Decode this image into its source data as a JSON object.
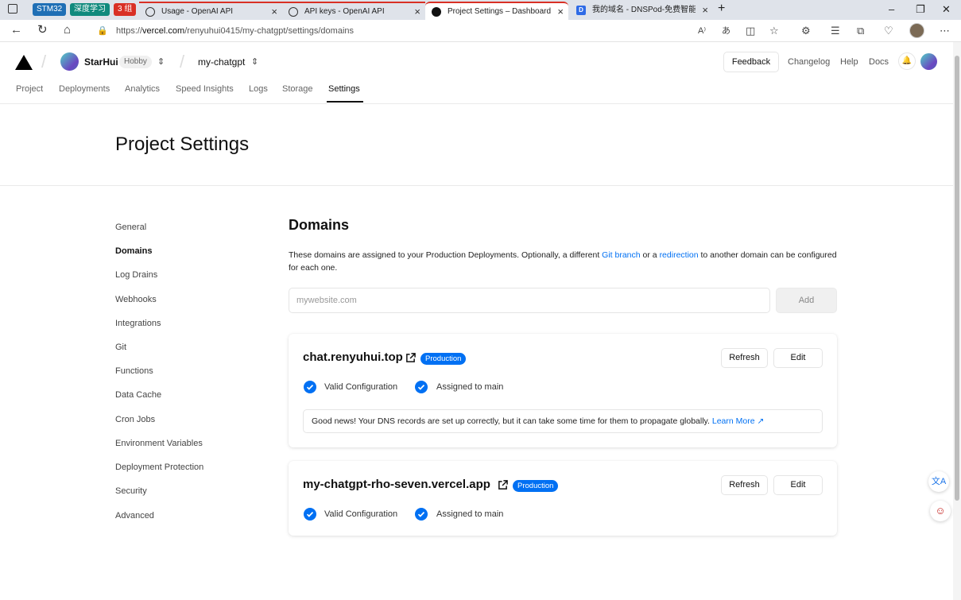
{
  "browser": {
    "tab_groups": [
      {
        "label": "STM32",
        "color": "#1f6fb5"
      },
      {
        "label": "深度学习",
        "color": "#108a7d"
      },
      {
        "label": "3 组",
        "color": "#d93025"
      }
    ],
    "tabs": [
      {
        "title": "Usage - OpenAI API",
        "icon": "openai-icon"
      },
      {
        "title": "API keys - OpenAI API",
        "icon": "openai-icon"
      },
      {
        "title": "Project Settings – Dashboard – V",
        "icon": "vercel-icon"
      },
      {
        "title": "我的域名 - DNSPod-免费智能DN",
        "icon": "dnspod-icon"
      }
    ],
    "url_prefix": "https://",
    "url_host": "vercel.com",
    "url_path": "/renyuhui0415/my-chatgpt/settings/domains"
  },
  "header": {
    "team_name": "StarHui",
    "plan_badge": "Hobby",
    "project_name": "my-chatgpt",
    "feedback": "Feedback",
    "changelog": "Changelog",
    "help": "Help",
    "docs": "Docs"
  },
  "nav": {
    "tabs": [
      "Project",
      "Deployments",
      "Analytics",
      "Speed Insights",
      "Logs",
      "Storage",
      "Settings"
    ],
    "active": "Settings"
  },
  "page_title": "Project Settings",
  "sidebar": {
    "items": [
      "General",
      "Domains",
      "Log Drains",
      "Webhooks",
      "Integrations",
      "Git",
      "Functions",
      "Data Cache",
      "Cron Jobs",
      "Environment Variables",
      "Deployment Protection",
      "Security",
      "Advanced"
    ],
    "active": "Domains"
  },
  "domains": {
    "heading": "Domains",
    "desc_part1": "These domains are assigned to your Production Deployments. Optionally, a different ",
    "git_branch_link": "Git branch",
    "desc_part2": " or a ",
    "redirection_link": "redirection",
    "desc_part3": " to another domain can be configured for each one.",
    "input_placeholder": "mywebsite.com",
    "add_label": "Add",
    "list": [
      {
        "name": "chat.renyuhui.top",
        "badge": "Production",
        "refresh": "Refresh",
        "edit": "Edit",
        "status_valid": "Valid Configuration",
        "status_assigned": "Assigned to main",
        "note_text": "Good news! Your DNS records are set up correctly, but it can take some time for them to propagate globally. ",
        "note_link": "Learn More"
      },
      {
        "name": "my-chatgpt-rho-seven.vercel.app",
        "badge": "Production",
        "refresh": "Refresh",
        "edit": "Edit",
        "status_valid": "Valid Configuration",
        "status_assigned": "Assigned to main"
      }
    ]
  },
  "colors": {
    "accent": "#0070f3",
    "tab_bar": "#dfe3ea"
  }
}
